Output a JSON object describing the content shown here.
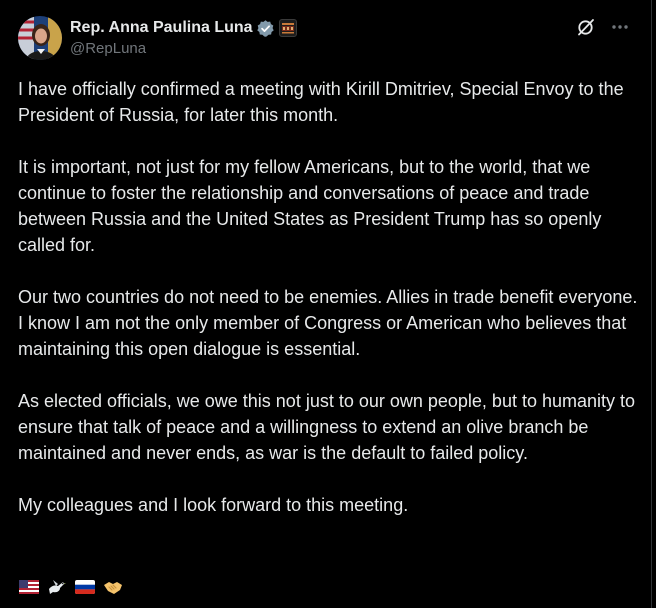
{
  "author": {
    "display_name": "Rep. Anna Paulina Luna",
    "handle": "@RepLuna",
    "avatar_icon": "profile-photo",
    "verified_icon": "verified-badge-icon",
    "affiliation_icon": "affiliation-badge-icon"
  },
  "actions": {
    "grok_icon": "grok-icon",
    "more_icon": "more-options-icon"
  },
  "post": {
    "paragraphs": [
      "I have officially confirmed a meeting with Kirill Dmitriev, Special Envoy to the President of Russia, for later this month.",
      "It is important, not just for my fellow Americans, but to the world, that we continue to foster the relationship and conversations of peace and trade between Russia and the United States as President Trump has so openly called for.",
      "Our two countries do not need to be enemies. Allies in trade benefit everyone. I know I am not the only member of Congress or American who believes that maintaining this open dialogue is essential.",
      "As elected officials, we owe this not just to our own people, but to humanity to ensure that talk of peace and a willingness to extend an olive branch be maintained and never ends, as war is the default to failed policy.",
      "My colleagues and I look forward to this meeting."
    ],
    "emojis": [
      "us-flag-emoji",
      "dove-emoji",
      "russia-flag-emoji",
      "handshake-emoji"
    ]
  },
  "colors": {
    "background": "#000000",
    "text": "#e7e9ea",
    "muted": "#71767b",
    "verified_gray": "#829aab"
  }
}
